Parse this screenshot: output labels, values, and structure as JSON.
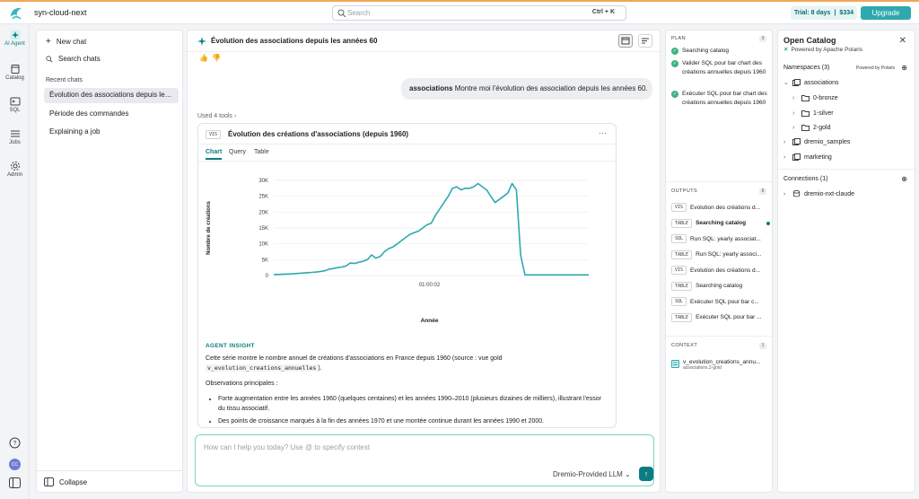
{
  "topbar": {
    "org_name": "syn-cloud-next",
    "search_placeholder": "Search",
    "search_shortcut": "Ctrl + K",
    "trial_label": "Trial: 8 days",
    "trial_sep": "|",
    "trial_amount": "$334",
    "upgrade_label": "Upgrade"
  },
  "rail": {
    "items": [
      {
        "label": "AI Agent",
        "icon": "sparkle-icon"
      },
      {
        "label": "Catalog",
        "icon": "catalog-icon"
      },
      {
        "label": "SQL",
        "icon": "sql-icon"
      },
      {
        "label": "Jobs",
        "icon": "jobs-icon"
      },
      {
        "label": "Admin",
        "icon": "gear-icon"
      }
    ],
    "avatar_initials": "CC"
  },
  "sidebar": {
    "new_chat": "New chat",
    "search_chats": "Search chats",
    "recent_label": "Recent chats",
    "chats": [
      "Évolution des associations depuis les années 1960",
      "Période des commandes",
      "Explaining a job"
    ],
    "collapse": "Collapse"
  },
  "main": {
    "title": "Évolution des associations depuis les années 60",
    "user_message_bold": "associations",
    "user_message_rest": " Montre moi l'évolution des association depuis les années 60.",
    "used_tools": "Used 4 tools",
    "viz": {
      "badge": "VIS",
      "title": "Évolution des créations d'associations (depuis 1960)",
      "tabs": [
        "Chart",
        "Query",
        "Table"
      ]
    },
    "insight": {
      "header": "AGENT INSIGHT",
      "para1_a": "Cette série montre le nombre annuel de créations d'associations en France depuis 1960 (source : vue gold",
      "para1_code": "v_evolution_creations_annuelles",
      "para1_b": ").",
      "obs_title": "Observations principales :",
      "bullets": [
        "Forte augmentation entre les années 1960 (quelques centaines) et les années 1990–2010 (plusieurs dizaines de milliers), illustrant l'essor du tissu associatif.",
        "Des points de croissance marqués à la fin des années 1970 et une montée continue durant les années 1990 et 2000."
      ]
    },
    "input": {
      "placeholder": "How can I help you today? Use @ to specify context",
      "model": "Dremio-Provided LLM ⌄"
    }
  },
  "plan": {
    "plan_title": "PLAN",
    "plan_count": "3",
    "steps": [
      "Searching catalog",
      "Valider SQL pour bar chart des créations annuelles depuis 1960",
      "Exécuter SQL pour bar chart des créations annuelles depuis 1960"
    ],
    "outputs_title": "OUTPUTS",
    "outputs_count": "8",
    "outputs": [
      {
        "badge": "VIS",
        "label": "Évolution des créations d..."
      },
      {
        "badge": "TABLE",
        "label": "Searching catalog"
      },
      {
        "badge": "SQL",
        "label": "Run SQL: yearly associat..."
      },
      {
        "badge": "TABLE",
        "label": "Run SQL: yearly associ..."
      },
      {
        "badge": "VIS",
        "label": "Évolution des créations d..."
      },
      {
        "badge": "TABLE",
        "label": "Searching catalog"
      },
      {
        "badge": "SQL",
        "label": "Exécuter SQL pour bar c..."
      },
      {
        "badge": "TABLE",
        "label": "Exécuter SQL pour bar ..."
      }
    ],
    "context_title": "CONTEXT",
    "context_count": "1",
    "context_item": "v_evolution_creations_annu...",
    "context_sub": "associations.2-gold"
  },
  "catalog": {
    "title": "Open Catalog",
    "subtitle": "Powered by Apache Polaris",
    "namespaces_label": "Namespaces (3)",
    "powered_small": "Powered by Polaris",
    "tree": [
      {
        "label": "associations",
        "level": 0,
        "chev": "⌄",
        "kind": "ns"
      },
      {
        "label": "0-bronze",
        "level": 1,
        "chev": "›",
        "kind": "folder"
      },
      {
        "label": "1-silver",
        "level": 1,
        "chev": "›",
        "kind": "folder"
      },
      {
        "label": "2-gold",
        "level": 1,
        "chev": "›",
        "kind": "folder"
      },
      {
        "label": "dremio_samples",
        "level": 0,
        "chev": "›",
        "kind": "ns"
      },
      {
        "label": "marketing",
        "level": 0,
        "chev": "›",
        "kind": "ns"
      }
    ],
    "connections_label": "Connections (1)",
    "connection": "dremio-nxt-claude"
  },
  "colors": {
    "accent": "#0a7c82",
    "series": "#2ea9ae",
    "check": "#3fb27f",
    "upgrade": "#2ea9ae"
  },
  "chart_data": {
    "type": "line",
    "xlabel": "Année",
    "ylabel": "Nombre de créations",
    "x_ticks": [
      "01:00:02"
    ],
    "y_ticks": [
      "0",
      "5K",
      "10K",
      "15K",
      "20K",
      "25K",
      "30K"
    ],
    "ylim": [
      0,
      30000
    ],
    "grid": true,
    "series": [
      {
        "values": [
          300,
          350,
          400,
          450,
          500,
          600,
          700,
          800,
          900,
          1000,
          1100,
          1300,
          1500,
          2000,
          2200,
          2500,
          2700,
          3000,
          4000,
          3800,
          4200,
          4500,
          5000,
          6500,
          5500,
          6000,
          7500,
          8500,
          9000,
          10000,
          11000,
          12000,
          13000,
          13500,
          14000,
          15000,
          16000,
          16500,
          19000,
          21000,
          23000,
          25000,
          27500,
          28000,
          27000,
          27500,
          27500,
          28000,
          29000,
          28000,
          27000,
          25000,
          23000,
          24000,
          25000,
          26000,
          29000,
          27000,
          6500,
          200,
          200,
          200,
          200,
          200,
          200,
          200,
          200,
          200,
          200,
          200,
          200,
          200,
          200,
          200,
          200
        ]
      }
    ]
  }
}
